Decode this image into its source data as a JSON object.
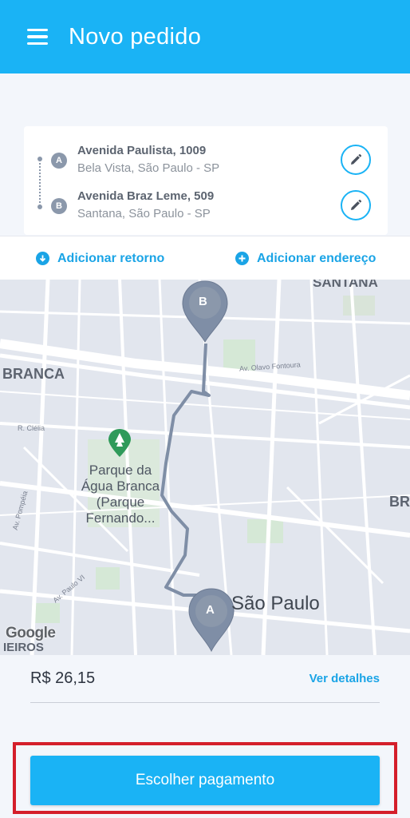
{
  "header": {
    "title": "Novo pedido",
    "bg_color": "#1ab3f5"
  },
  "route": {
    "stops": [
      {
        "badge": "A",
        "street": "Avenida Paulista, 1009",
        "area": "Bela Vista, São Paulo - SP"
      },
      {
        "badge": "B",
        "street": "Avenida Braz Leme, 509",
        "area": "Santana, São Paulo - SP"
      }
    ]
  },
  "actions": {
    "add_return": "Adicionar retorno",
    "add_address": "Adicionar endereço"
  },
  "map": {
    "labels": {
      "santana": "SANTANA",
      "branca": "BRANCA",
      "av_olavo": "Av. Olavo Fontoura",
      "r_clelia": "R. Clélia",
      "park_line1": "Parque da",
      "park_line2": "Água Branca",
      "park_line3": "(Parque",
      "park_line4": "Fernando...",
      "br": "BR",
      "av_pompeia": "Av. Pompéia",
      "av_paulo_vi": "Av. Paulo VI",
      "sao_paulo": "São Paulo",
      "perdizes": "IEIROS",
      "google": "Google"
    },
    "pins": {
      "a": "A",
      "b": "B"
    }
  },
  "summary": {
    "price": "R$ 26,15",
    "details_link": "Ver detalhes"
  },
  "footer": {
    "pay_button": "Escolher pagamento"
  },
  "colors": {
    "accent": "#1ab3f5",
    "link": "#1aa4e6",
    "highlight_border": "#d41f2b",
    "route_line": "#7f8ea6"
  }
}
